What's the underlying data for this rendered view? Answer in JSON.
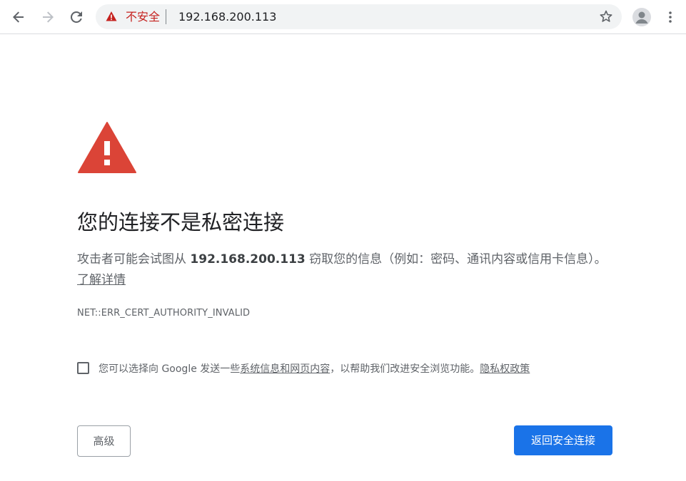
{
  "browser": {
    "back_icon": "arrow-left-icon",
    "forward_icon": "arrow-right-icon",
    "reload_icon": "reload-icon",
    "omnibox": {
      "security_icon": "warning-triangle-icon",
      "security_status": "不安全",
      "url": "192.168.200.113",
      "bookmark_icon": "star-icon"
    },
    "profile_icon": "avatar-icon",
    "menu_icon": "kebab-menu-icon"
  },
  "interstitial": {
    "icon": "warning-triangle-icon",
    "icon_color": "#db4437",
    "title": "您的连接不是私密连接",
    "desc_prefix": "攻击者可能会试图从 ",
    "desc_host": "192.168.200.113",
    "desc_suffix": " 窃取您的信息（例如：密码、通讯内容或信用卡信息）。",
    "learn_more_link": "了解详情",
    "error_code": "NET::ERR_CERT_AUTHORITY_INVALID",
    "optin": {
      "checked": false,
      "text_prefix": "您可以选择向 Google 发送一些",
      "system_info_link": "系统信息和网页内容",
      "text_middle": "，以帮助我们改进安全浏览功能。",
      "privacy_link": "隐私权政策"
    },
    "advanced_button": "高级",
    "back_to_safety_button": "返回安全连接",
    "primary_color": "#1a73e8"
  }
}
